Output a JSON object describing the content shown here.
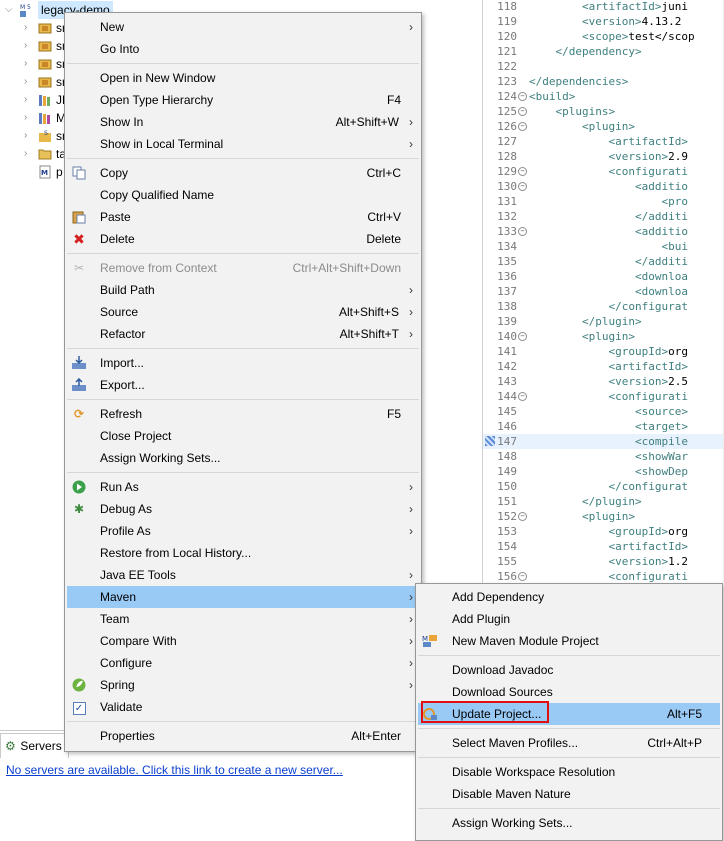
{
  "explorer": {
    "root_label": "legacy-demo",
    "items": [
      {
        "label": "sr",
        "icon": "package-source-icon"
      },
      {
        "label": "sr",
        "icon": "package-source-icon"
      },
      {
        "label": "sr",
        "icon": "package-source-icon"
      },
      {
        "label": "sr",
        "icon": "package-source-icon"
      },
      {
        "label": "JR",
        "icon": "jre-library-icon"
      },
      {
        "label": "M",
        "icon": "maven-dependencies-icon"
      },
      {
        "label": "sr",
        "icon": "src-folder-icon"
      },
      {
        "label": "ta",
        "icon": "folder-icon"
      },
      {
        "label": "p",
        "icon": "pom-file-icon"
      }
    ]
  },
  "editor": {
    "lines": [
      {
        "n": "118",
        "fold": false,
        "indent": "        ",
        "tag": "<artifactId>",
        "text": "juni"
      },
      {
        "n": "119",
        "fold": false,
        "indent": "        ",
        "tag": "<version>",
        "text": "4.13.2"
      },
      {
        "n": "120",
        "fold": false,
        "indent": "        ",
        "tag": "<scope>",
        "text": "test</scop"
      },
      {
        "n": "121",
        "fold": false,
        "indent": "    ",
        "tag": "</dependency>",
        "text": ""
      },
      {
        "n": "122",
        "fold": false,
        "indent": "",
        "tag": "",
        "text": ""
      },
      {
        "n": "123",
        "fold": false,
        "indent": "",
        "tag": "</dependencies>",
        "text": ""
      },
      {
        "n": "124",
        "fold": true,
        "indent": "",
        "tag": "<build>",
        "text": ""
      },
      {
        "n": "125",
        "fold": true,
        "indent": "    ",
        "tag": "<plugins>",
        "text": ""
      },
      {
        "n": "126",
        "fold": true,
        "indent": "        ",
        "tag": "<plugin>",
        "text": ""
      },
      {
        "n": "127",
        "fold": false,
        "indent": "            ",
        "tag": "<artifactId>",
        "text": ""
      },
      {
        "n": "128",
        "fold": false,
        "indent": "            ",
        "tag": "<version>",
        "text": "2.9"
      },
      {
        "n": "129",
        "fold": true,
        "indent": "            ",
        "tag": "<configurati",
        "text": ""
      },
      {
        "n": "130",
        "fold": true,
        "indent": "                ",
        "tag": "<additio",
        "text": ""
      },
      {
        "n": "131",
        "fold": false,
        "indent": "                    ",
        "tag": "<pro",
        "text": ""
      },
      {
        "n": "132",
        "fold": false,
        "indent": "                ",
        "tag": "</additi",
        "text": ""
      },
      {
        "n": "133",
        "fold": true,
        "indent": "                ",
        "tag": "<additio",
        "text": ""
      },
      {
        "n": "134",
        "fold": false,
        "indent": "                    ",
        "tag": "<bui",
        "text": ""
      },
      {
        "n": "135",
        "fold": false,
        "indent": "                ",
        "tag": "</additi",
        "text": ""
      },
      {
        "n": "136",
        "fold": false,
        "indent": "                ",
        "tag": "<downloa",
        "text": ""
      },
      {
        "n": "137",
        "fold": false,
        "indent": "                ",
        "tag": "<downloa",
        "text": ""
      },
      {
        "n": "138",
        "fold": false,
        "indent": "            ",
        "tag": "</configurat",
        "text": ""
      },
      {
        "n": "139",
        "fold": false,
        "indent": "        ",
        "tag": "</plugin>",
        "text": ""
      },
      {
        "n": "140",
        "fold": true,
        "indent": "        ",
        "tag": "<plugin>",
        "text": ""
      },
      {
        "n": "141",
        "fold": false,
        "indent": "            ",
        "tag": "<groupId>",
        "text": "org"
      },
      {
        "n": "142",
        "fold": false,
        "indent": "            ",
        "tag": "<artifactId>",
        "text": ""
      },
      {
        "n": "143",
        "fold": false,
        "indent": "            ",
        "tag": "<version>",
        "text": "2.5"
      },
      {
        "n": "144",
        "fold": true,
        "indent": "            ",
        "tag": "<configurati",
        "text": ""
      },
      {
        "n": "145",
        "fold": false,
        "indent": "                ",
        "tag": "<source>",
        "text": ""
      },
      {
        "n": "146",
        "fold": false,
        "indent": "                ",
        "tag": "<target>",
        "text": ""
      },
      {
        "n": "147",
        "fold": false,
        "indent": "                ",
        "tag": "<compile",
        "text": ""
      },
      {
        "n": "148",
        "fold": false,
        "indent": "                ",
        "tag": "<showWar",
        "text": ""
      },
      {
        "n": "149",
        "fold": false,
        "indent": "                ",
        "tag": "<showDep",
        "text": ""
      },
      {
        "n": "150",
        "fold": false,
        "indent": "            ",
        "tag": "</configurat",
        "text": ""
      },
      {
        "n": "151",
        "fold": false,
        "indent": "        ",
        "tag": "</plugin>",
        "text": ""
      },
      {
        "n": "152",
        "fold": true,
        "indent": "        ",
        "tag": "<plugin>",
        "text": ""
      },
      {
        "n": "153",
        "fold": false,
        "indent": "            ",
        "tag": "<groupId>",
        "text": "org"
      },
      {
        "n": "154",
        "fold": false,
        "indent": "            ",
        "tag": "<artifactId>",
        "text": ""
      },
      {
        "n": "155",
        "fold": false,
        "indent": "            ",
        "tag": "<version>",
        "text": "1.2"
      },
      {
        "n": "156",
        "fold": true,
        "indent": "            ",
        "tag": "<configurati",
        "text": ""
      }
    ]
  },
  "servers": {
    "tab_label": "Servers",
    "empty_link": "No servers are available. Click this link to create a new server..."
  },
  "context_menu": {
    "items": [
      {
        "label": "New",
        "shortcut": "",
        "submenu": true,
        "icon": ""
      },
      {
        "label": "Go Into",
        "shortcut": "",
        "submenu": false,
        "icon": ""
      },
      {
        "sep": true
      },
      {
        "label": "Open in New Window",
        "shortcut": "",
        "submenu": false,
        "icon": ""
      },
      {
        "label": "Open Type Hierarchy",
        "shortcut": "F4",
        "submenu": false,
        "icon": ""
      },
      {
        "label": "Show In",
        "shortcut": "Alt+Shift+W",
        "submenu": true,
        "icon": ""
      },
      {
        "label": "Show in Local Terminal",
        "shortcut": "",
        "submenu": true,
        "icon": ""
      },
      {
        "sep": true
      },
      {
        "label": "Copy",
        "shortcut": "Ctrl+C",
        "submenu": false,
        "icon": "copy-icon"
      },
      {
        "label": "Copy Qualified Name",
        "shortcut": "",
        "submenu": false,
        "icon": ""
      },
      {
        "label": "Paste",
        "shortcut": "Ctrl+V",
        "submenu": false,
        "icon": "paste-icon"
      },
      {
        "label": "Delete",
        "shortcut": "Delete",
        "submenu": false,
        "icon": "delete-icon"
      },
      {
        "sep": true
      },
      {
        "label": "Remove from Context",
        "shortcut": "Ctrl+Alt+Shift+Down",
        "submenu": false,
        "icon": "remove-context-icon",
        "disabled": true
      },
      {
        "label": "Build Path",
        "shortcut": "",
        "submenu": true,
        "icon": ""
      },
      {
        "label": "Source",
        "shortcut": "Alt+Shift+S",
        "submenu": true,
        "icon": ""
      },
      {
        "label": "Refactor",
        "shortcut": "Alt+Shift+T",
        "submenu": true,
        "icon": ""
      },
      {
        "sep": true
      },
      {
        "label": "Import...",
        "shortcut": "",
        "submenu": false,
        "icon": "import-icon"
      },
      {
        "label": "Export...",
        "shortcut": "",
        "submenu": false,
        "icon": "export-icon"
      },
      {
        "sep": true
      },
      {
        "label": "Refresh",
        "shortcut": "F5",
        "submenu": false,
        "icon": "refresh-icon"
      },
      {
        "label": "Close Project",
        "shortcut": "",
        "submenu": false,
        "icon": ""
      },
      {
        "label": "Assign Working Sets...",
        "shortcut": "",
        "submenu": false,
        "icon": ""
      },
      {
        "sep": true
      },
      {
        "label": "Run As",
        "shortcut": "",
        "submenu": true,
        "icon": "run-icon"
      },
      {
        "label": "Debug As",
        "shortcut": "",
        "submenu": true,
        "icon": "debug-icon"
      },
      {
        "label": "Profile As",
        "shortcut": "",
        "submenu": true,
        "icon": ""
      },
      {
        "label": "Restore from Local History...",
        "shortcut": "",
        "submenu": false,
        "icon": ""
      },
      {
        "label": "Java EE Tools",
        "shortcut": "",
        "submenu": true,
        "icon": ""
      },
      {
        "label": "Maven",
        "shortcut": "",
        "submenu": true,
        "icon": "",
        "active": true
      },
      {
        "label": "Team",
        "shortcut": "",
        "submenu": true,
        "icon": ""
      },
      {
        "label": "Compare With",
        "shortcut": "",
        "submenu": true,
        "icon": ""
      },
      {
        "label": "Configure",
        "shortcut": "",
        "submenu": true,
        "icon": ""
      },
      {
        "label": "Spring",
        "shortcut": "",
        "submenu": true,
        "icon": "spring-icon"
      },
      {
        "label": "Validate",
        "shortcut": "",
        "submenu": false,
        "icon": "validate-checkbox-icon"
      },
      {
        "sep": true
      },
      {
        "label": "Properties",
        "shortcut": "Alt+Enter",
        "submenu": false,
        "icon": ""
      }
    ]
  },
  "maven_menu": {
    "items": [
      {
        "label": "Add Dependency",
        "shortcut": "",
        "icon": ""
      },
      {
        "label": "Add Plugin",
        "shortcut": "",
        "icon": ""
      },
      {
        "label": "New Maven Module Project",
        "shortcut": "",
        "icon": "maven-module-icon"
      },
      {
        "sep": true
      },
      {
        "label": "Download Javadoc",
        "shortcut": "",
        "icon": ""
      },
      {
        "label": "Download Sources",
        "shortcut": "",
        "icon": ""
      },
      {
        "label": "Update Project...",
        "shortcut": "Alt+F5",
        "icon": "update-project-icon",
        "active": true
      },
      {
        "sep": true
      },
      {
        "label": "Select Maven Profiles...",
        "shortcut": "Ctrl+Alt+P",
        "icon": ""
      },
      {
        "sep": true
      },
      {
        "label": "Disable Workspace Resolution",
        "shortcut": "",
        "icon": ""
      },
      {
        "label": "Disable Maven Nature",
        "shortcut": "",
        "icon": ""
      },
      {
        "sep": true
      },
      {
        "label": "Assign Working Sets...",
        "shortcut": "",
        "icon": ""
      }
    ]
  },
  "colors": {
    "menu_bg": "#f2f2f2",
    "menu_active": "#99c9f5",
    "highlight_box": "#e01010",
    "link": "#0b3fd0",
    "xml_tag": "#3f7f7f"
  }
}
